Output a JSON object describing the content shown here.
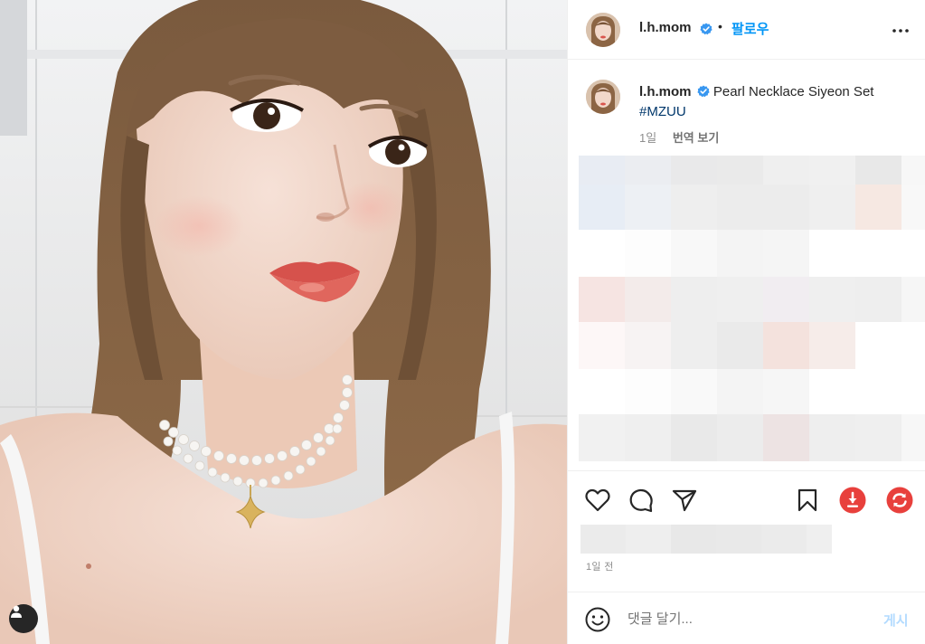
{
  "post": {
    "username": "l.h.mom",
    "follow_label": "팔로우",
    "separator": "•",
    "caption": "Pearl Necklace Siyeon Set",
    "hashtag": "#MZUU",
    "caption_age": "1일",
    "translate_label": "번역 보기",
    "posted_ago": "1일 전"
  },
  "comment_box": {
    "placeholder": "댓글 달기...",
    "post_label": "게시"
  },
  "icons": {
    "more": "more-horizontal-icon",
    "verified": "verified-badge-icon",
    "like": "heart-icon",
    "comment": "speech-bubble-icon",
    "share": "paper-plane-icon",
    "save": "bookmark-icon",
    "download": "download-icon",
    "refresh": "refresh-icon",
    "emoji": "emoji-icon",
    "user_tags": "user-icon"
  },
  "colors": {
    "accent": "#0095f6",
    "verified": "#3897f0",
    "download": "#e8403c",
    "refresh": "#e8403c",
    "post_disabled": "#b3dbff"
  }
}
